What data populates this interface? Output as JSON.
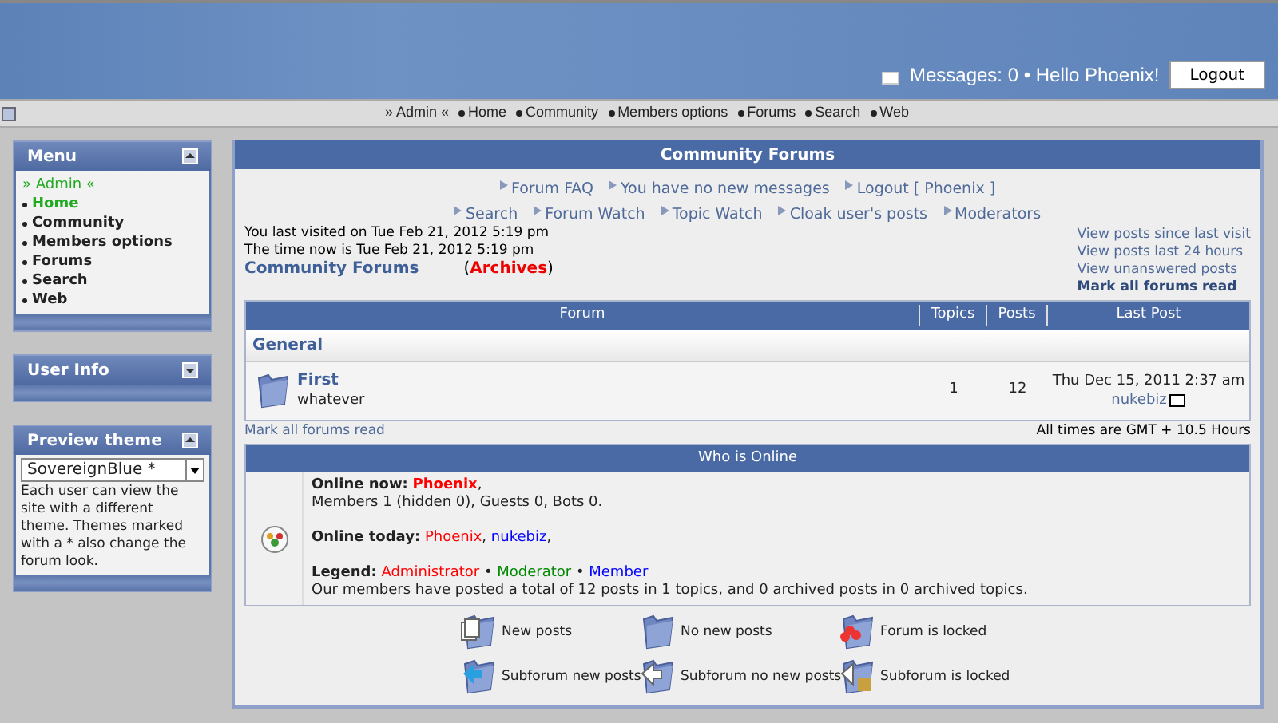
{
  "header": {
    "messages": "Messages: 0 • Hello Phoenix!",
    "logout": "Logout"
  },
  "nav": {
    "items": [
      {
        "label": "» Admin «",
        "kind": "admin"
      },
      {
        "label": "Home",
        "kind": "item"
      },
      {
        "label": "Community",
        "kind": "item"
      },
      {
        "label": "Members options",
        "kind": "item"
      },
      {
        "label": "Forums",
        "kind": "item"
      },
      {
        "label": "Search",
        "kind": "item"
      },
      {
        "label": "Web",
        "kind": "item"
      }
    ]
  },
  "sidebar": {
    "blocks": [
      {
        "title": "Menu",
        "expanded": true,
        "kind": "menu",
        "items": [
          {
            "label": "» Admin «",
            "kind": "admin",
            "selected": false
          },
          {
            "label": "Home",
            "kind": "item",
            "selected": true
          },
          {
            "label": "Community",
            "kind": "item",
            "selected": false
          },
          {
            "label": "Members options",
            "kind": "item",
            "selected": false
          },
          {
            "label": "Forums",
            "kind": "item",
            "selected": false
          },
          {
            "label": "Search",
            "kind": "item",
            "selected": false
          },
          {
            "label": "Web",
            "kind": "item",
            "selected": false
          }
        ]
      },
      {
        "title": "User Info",
        "expanded": false,
        "kind": "empty"
      },
      {
        "title": "Preview theme",
        "expanded": true,
        "kind": "theme",
        "select": "SovereignBlue *",
        "text": "Each user can view the site with a different theme. Themes marked with a * also change the forum look."
      }
    ]
  },
  "main": {
    "title": "Community Forums",
    "links_row1": [
      "Forum FAQ",
      "You have no new messages",
      "Logout [ Phoenix ]"
    ],
    "links_row2": [
      "Search",
      "Forum Watch",
      "Topic Watch",
      "Cloak user's posts",
      "Moderators"
    ],
    "last_visit": "You last visited on Tue Feb 21, 2012 5:19 pm",
    "time_now": "The time now is Tue Feb 21, 2012 5:19 pm",
    "breadcrumb": "Community Forums",
    "archives": "(**Archives**)",
    "right_links": [
      {
        "label": "View posts since last visit",
        "bold": false
      },
      {
        "label": "View posts last 24 hours",
        "bold": false
      },
      {
        "label": "View unanswered posts",
        "bold": false
      },
      {
        "label": "Mark all forums read",
        "bold": true
      }
    ],
    "table": {
      "columns": [
        "Forum",
        "Topics",
        "Posts",
        "Last Post"
      ],
      "category": "General",
      "rows": [
        {
          "name": "First",
          "description": "whatever",
          "topics": "1",
          "posts": "12",
          "last_post_date": "Thu Dec 15, 2011 2:37 am",
          "last_post_user": "nukebiz"
        }
      ]
    },
    "mark_read": "Mark all forums read",
    "timezone": "All times are GMT + 10.5 Hours",
    "who": {
      "title": "Who is Online",
      "online_now_label": "Online now:",
      "online_now_users": [
        {
          "name": "Phoenix",
          "color": "#ff0000",
          "suffix": ","
        }
      ],
      "members": "Members 1 (hidden 0), Guests 0, Bots 0.",
      "online_today_label": "Online today:",
      "online_today_users": [
        {
          "name": "Phoenix",
          "color": "#ff0000",
          "suffix": ","
        },
        {
          "name": "nukebiz",
          "color": "#0000ff",
          "suffix": ","
        }
      ],
      "legend_label": "Legend:",
      "legend_separator": "•",
      "legend": [
        {
          "name": "Administrator",
          "color": "#ff0000"
        },
        {
          "name": "Moderator",
          "color": "#008800"
        },
        {
          "name": "Member",
          "color": "#0000ff"
        }
      ],
      "stats": "Our members have posted a total of 12 posts in 1 topics, and 0 archived posts in 0 archived topics."
    },
    "icon_legend": [
      {
        "label": "New posts",
        "kind": "new"
      },
      {
        "label": "No new posts",
        "kind": "none"
      },
      {
        "label": "Forum is locked",
        "kind": "locked"
      },
      {
        "label": "Subforum new posts",
        "kind": "sub_new"
      },
      {
        "label": "Subforum no new posts",
        "kind": "sub_none"
      },
      {
        "label": "Subforum is locked",
        "kind": "sub_locked"
      }
    ]
  }
}
